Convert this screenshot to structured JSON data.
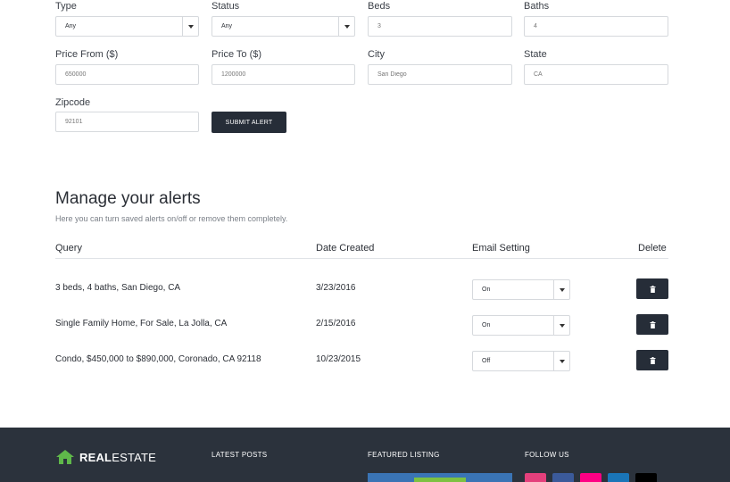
{
  "form": {
    "type": {
      "label": "Type",
      "value": "Any"
    },
    "status": {
      "label": "Status",
      "value": "Any"
    },
    "beds": {
      "label": "Beds",
      "placeholder": "3"
    },
    "baths": {
      "label": "Baths",
      "placeholder": "4"
    },
    "price_from": {
      "label": "Price From ($)",
      "placeholder": "650000"
    },
    "price_to": {
      "label": "Price To ($)",
      "placeholder": "1200000"
    },
    "city": {
      "label": "City",
      "placeholder": "San Diego"
    },
    "state": {
      "label": "State",
      "placeholder": "CA"
    },
    "zipcode": {
      "label": "Zipcode",
      "placeholder": "92101"
    },
    "submit_label": "SUBMIT ALERT"
  },
  "alerts": {
    "title": "Manage your alerts",
    "subtitle": "Here you can turn saved alerts on/off or remove them completely.",
    "columns": {
      "query": "Query",
      "date": "Date Created",
      "email": "Email Setting",
      "delete": "Delete"
    },
    "rows": [
      {
        "query": "3 beds, 4 baths, San Diego, CA",
        "date": "3/23/2016",
        "email": "On"
      },
      {
        "query": "Single Family Home, For Sale, La Jolla, CA",
        "date": "2/15/2016",
        "email": "On"
      },
      {
        "query": "Condo, $450,000 to $890,000, Coronado, CA 92118",
        "date": "10/23/2015",
        "email": "Off"
      }
    ]
  },
  "footer": {
    "brand_bold": "REAL",
    "brand_light": "ESTATE",
    "latest_posts": "LATEST POSTS",
    "featured_listing": "FEATURED LISTING",
    "follow_us": "FOLLOW US",
    "social": [
      {
        "icon": "instagram-icon",
        "color": "#e4407c"
      },
      {
        "icon": "facebook-icon",
        "color": "#3b5a9a"
      },
      {
        "icon": "flickr-icon",
        "color": "#ff0084"
      },
      {
        "icon": "linkedin-icon",
        "color": "#1a75b8"
      },
      {
        "icon": "github-icon",
        "color": "#000000"
      }
    ]
  }
}
